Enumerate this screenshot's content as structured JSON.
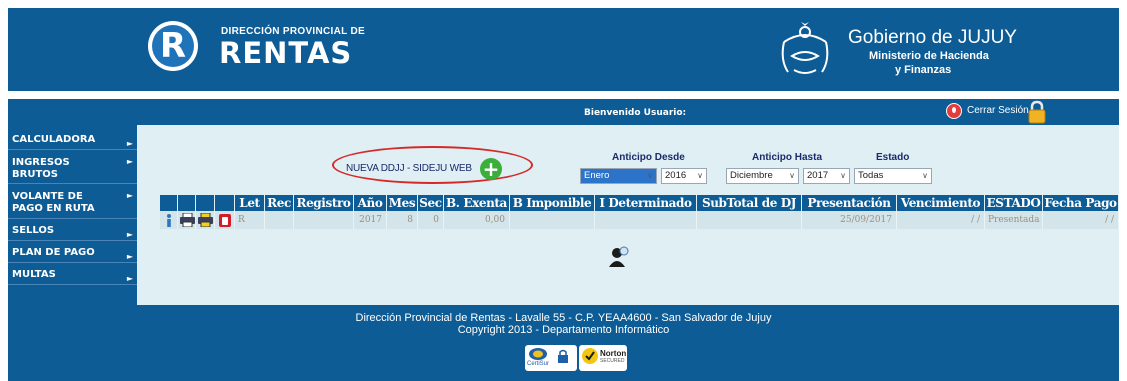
{
  "header": {
    "brand_small": "DIRECCIÓN PROVINCIAL DE",
    "brand_big": "RENTAS",
    "logo_letter": "R",
    "gov_title": "Gobierno de JUJUY",
    "gov_sub1": "Ministerio de Hacienda",
    "gov_sub2": "y Finanzas"
  },
  "topbar": {
    "welcome": "Bienvenido Usuario:",
    "logout_label": "Cerrar Sesión"
  },
  "sidebar": {
    "items": [
      {
        "line1": "CALCULADORA",
        "line2": ""
      },
      {
        "line1": "INGRESOS",
        "line2": "BRUTOS"
      },
      {
        "line1": "VOLANTE DE",
        "line2": "PAGO EN RUTA"
      },
      {
        "line1": "SELLOS",
        "line2": ""
      },
      {
        "line1": "PLAN DE PAGO",
        "line2": ""
      },
      {
        "line1": "MULTAS",
        "line2": ""
      }
    ],
    "arrow": "►"
  },
  "toolbar": {
    "new_label": "NUEVA DDJJ - SIDEJU WEB",
    "add_symbol": "+"
  },
  "filters": {
    "desde_label": "Anticipo Desde",
    "hasta_label": "Anticipo Hasta",
    "estado_label": "Estado",
    "desde_month": "Enero",
    "desde_year": "2016",
    "hasta_month": "Diciembre",
    "hasta_year": "2017",
    "estado": "Todas",
    "chevron": "∨"
  },
  "table": {
    "headers": [
      "Let",
      "Rec",
      "Registro",
      "Año",
      "Mes",
      "Sec",
      "B. Exenta",
      "B Imponible",
      "I Determinado",
      "SubTotal de DJ",
      "Presentación",
      "Vencimiento",
      "ESTADO",
      "Fecha Pago"
    ],
    "row": {
      "let": "R",
      "rec": "",
      "registro": "",
      "anio": "2017",
      "mes": "8",
      "sec": "0",
      "b_exenta": "0,00",
      "b_imponible": "",
      "i_determinado": "",
      "subtotal": "",
      "presentacion": "25/09/2017",
      "vencimiento": "/ /",
      "estado": "Presentada",
      "fecha_pago": "/ /"
    }
  },
  "footer": {
    "line1": "Dirección Provincial de Rentas - Lavalle 55 - C.P. YEAA4600 - San Salvador de Jujuy",
    "line2": "Copyright 2013 - Departamento Informático",
    "badge1": "CertiSur",
    "badge2": "Norton",
    "badge2_sub": "SECURED"
  },
  "colors": {
    "brand_blue": "#0d5c96",
    "content_bg": "#dfeff3",
    "highlight_red": "#d52a2a",
    "add_green": "#3cae3c"
  }
}
